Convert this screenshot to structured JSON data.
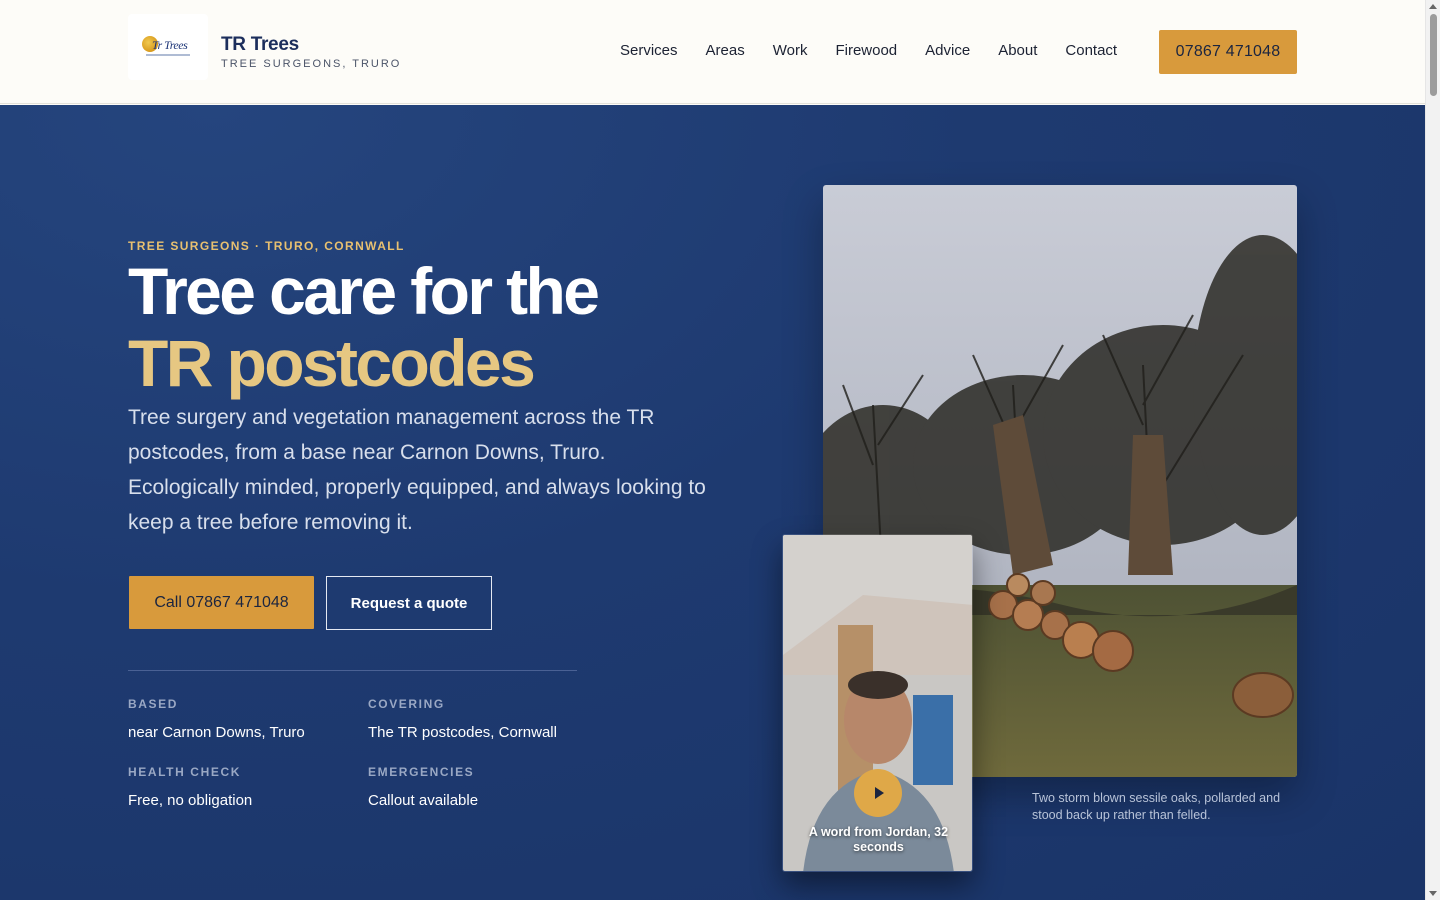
{
  "header": {
    "logo_text": "Tr Trees",
    "brand_name": "TR Trees",
    "brand_sub": "TREE SURGEONS, TRURO",
    "nav": [
      "Services",
      "Areas",
      "Work",
      "Firewood",
      "Advice",
      "About",
      "Contact"
    ],
    "phone": "07867 471048"
  },
  "hero": {
    "eyebrow": "TREE SURGEONS · TRURO, CORNWALL",
    "title_line1": "Tree care for the",
    "title_line2": "TR postcodes",
    "lead": "Tree surgery and vegetation management across the TR postcodes, from a base near Carnon Downs, Truro. Ecologically minded, properly equipped, and always looking to keep a tree before removing it.",
    "cta_call": "Call 07867 471048",
    "cta_quote": "Request a quote",
    "facts": [
      {
        "label": "BASED",
        "value": "near Carnon Downs, Truro"
      },
      {
        "label": "COVERING",
        "value": "The TR postcodes, Cornwall"
      },
      {
        "label": "HEALTH CHECK",
        "value": "Free, no obligation"
      },
      {
        "label": "EMERGENCIES",
        "value": "Callout available"
      }
    ],
    "photo_caption": "Two storm blown sessile oaks, pollarded and stood back up rather than felled.",
    "video_label": "A word from Jordan, 32 seconds"
  },
  "colors": {
    "accent": "#d89a3c",
    "hero_bg": "#1e3a70",
    "highlight": "#e6c782"
  },
  "icons": {
    "play": "play-icon"
  }
}
